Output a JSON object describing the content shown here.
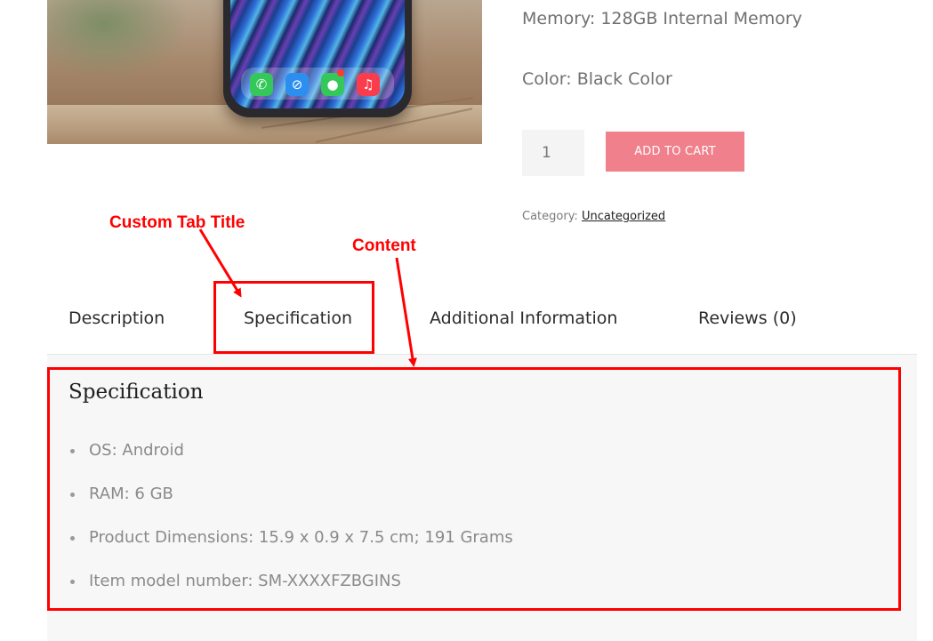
{
  "product": {
    "memory": "Memory: 128GB Internal Memory",
    "color": "Color: Black Color",
    "quantity": "1",
    "add_to_cart": "ADD TO CART",
    "category_label": "Category:",
    "category_value": "Uncategorized"
  },
  "annotations": {
    "tab_title": "Custom Tab Title",
    "content": "Content"
  },
  "tabs": [
    {
      "label": "Description"
    },
    {
      "label": "Specification"
    },
    {
      "label": "Additional Information"
    },
    {
      "label": "Reviews (0)"
    }
  ],
  "panel": {
    "title": "Specification",
    "items": [
      "OS: Android",
      "RAM: 6 GB",
      "Product Dimensions: 15.9 x 0.9 x 7.5 cm; 191 Grams",
      "Item model number: SM-XXXXFZBGINS"
    ]
  },
  "colors": {
    "accent_button": "#f0808b",
    "annotation_red": "#ff0000",
    "panel_bg": "#f7f7f7"
  }
}
